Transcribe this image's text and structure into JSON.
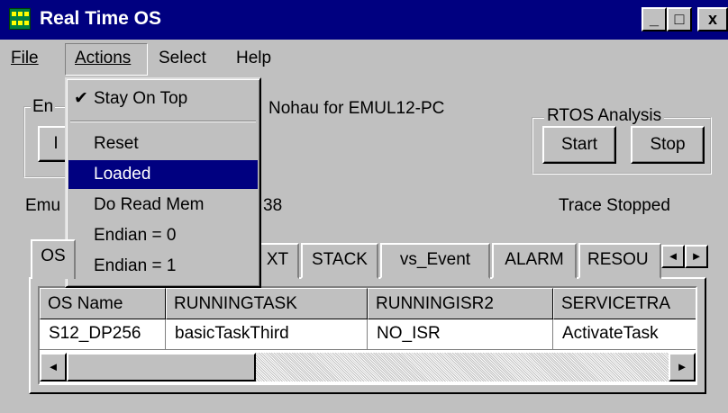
{
  "window": {
    "title": "Real Time OS",
    "icon": "app-chip-icon",
    "controls": {
      "minimize": "_",
      "maximize": "□",
      "close": "x"
    }
  },
  "menubar": {
    "file": "File",
    "actions": "Actions",
    "select": "Select",
    "help": "Help"
  },
  "actions_menu": {
    "items": [
      {
        "label": "Stay On Top",
        "checked": true,
        "check_glyph": "✔"
      },
      {
        "label": "Reset"
      },
      {
        "label": "Loaded",
        "selected": true
      },
      {
        "label": "Do Read Mem"
      },
      {
        "label": "Endian = 0"
      },
      {
        "label": "Endian = 1"
      }
    ]
  },
  "emulator_group": {
    "label_partial": "En",
    "button_partial": "I"
  },
  "product_text": "Nohau for EMUL12-PC",
  "rtos_group": {
    "label": "RTOS  Analysis",
    "start": "Start",
    "stop": "Stop"
  },
  "status": {
    "left_partial": "Emu",
    "left_tail": "38",
    "trace": "Trace Stopped"
  },
  "tabs": {
    "first_partial": "OS",
    "context_partial": "XT",
    "stack": "STACK",
    "event": "vs_Event",
    "alarm": "ALARM",
    "resource_partial": "RESOU",
    "scroll_left": "◄",
    "scroll_right": "►"
  },
  "grid": {
    "columns": [
      "OS Name",
      "RUNNINGTASK",
      "RUNNINGISR2",
      "SERVICETRA"
    ],
    "rows": [
      [
        "S12_DP256",
        "basicTaskThird",
        "NO_ISR",
        "ActivateTask"
      ]
    ],
    "scroll_left": "◄",
    "scroll_right": "►"
  },
  "colors": {
    "title_bar": "#000080",
    "face": "#c0c0c0",
    "highlight": "#000080"
  }
}
